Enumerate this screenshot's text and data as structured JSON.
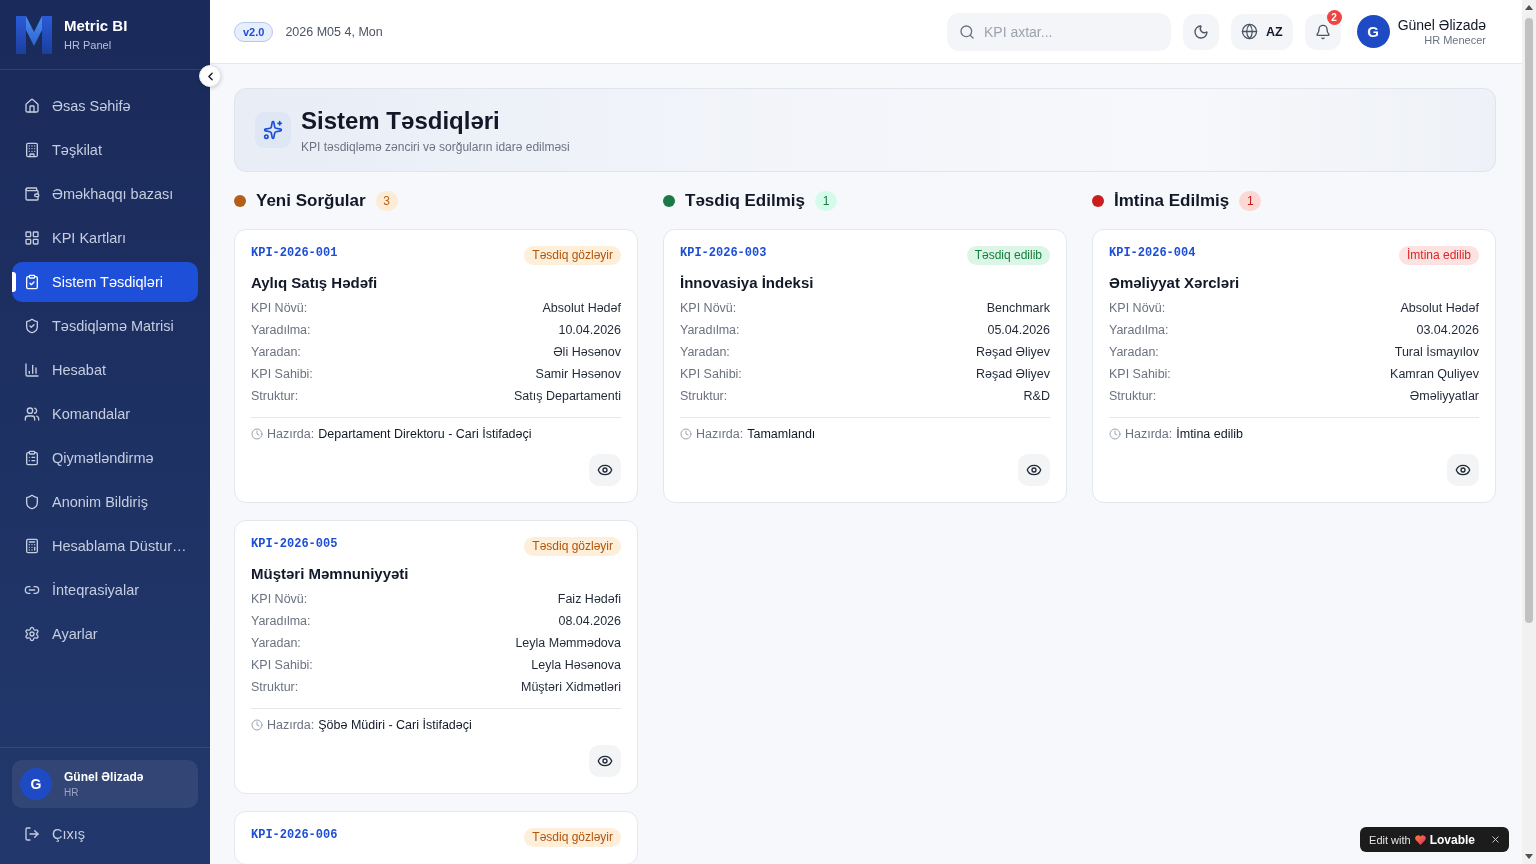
{
  "sidebar": {
    "brand": {
      "name": "Metric BI",
      "subtitle": "HR Panel"
    },
    "nav": [
      {
        "label": "Əsas Səhifə",
        "selected": false
      },
      {
        "label": "Təşkilat",
        "selected": false
      },
      {
        "label": "Əməkhaqqı bazası",
        "selected": false
      },
      {
        "label": "KPI Kartları",
        "selected": false
      },
      {
        "label": "Sistem Təsdiqləri",
        "selected": true
      },
      {
        "label": "Təsdiqləmə Matrisi",
        "selected": false
      },
      {
        "label": "Hesabat",
        "selected": false
      },
      {
        "label": "Komandalar",
        "selected": false
      },
      {
        "label": "Qiymətləndirmə",
        "selected": false
      },
      {
        "label": "Anonim Bildiriş",
        "selected": false
      },
      {
        "label": "Hesablama Düstur…",
        "selected": false
      },
      {
        "label": "İnteqrasiyalar",
        "selected": false
      },
      {
        "label": "Ayarlar",
        "selected": false
      }
    ],
    "user": {
      "initial": "G",
      "name": "Günel Əlizadə",
      "role": "HR"
    },
    "logout": "Çıxış"
  },
  "header": {
    "version": "v2.0",
    "date": "2026 M05 4, Mon",
    "search": {
      "placeholder": "KPI axtar..."
    },
    "language": "AZ",
    "notifications": "2",
    "user": {
      "initial": "G",
      "name": "Günel Əlizadə",
      "role": "HR Menecer"
    }
  },
  "page": {
    "title": "Sistem Təsdiqləri",
    "subtitle": "KPI təsdiqləmə zənciri və sorğuların idarə edilməsi"
  },
  "columns": [
    {
      "title": "Yeni Sorğular",
      "count": "3",
      "color": "#b45f17",
      "cards": [
        {
          "id": "KPI-2026-001",
          "status": {
            "label": "Təsdiq gözləyir",
            "kind": "pending"
          },
          "title": "Aylıq Satış Hədəfi",
          "fields": [
            {
              "label": "KPI Növü:",
              "value": "Absolut Hədəf"
            },
            {
              "label": "Yaradılma:",
              "value": "10.04.2026"
            },
            {
              "label": "Yaradan:",
              "value": "Əli Həsənov"
            },
            {
              "label": "KPI Sahibi:",
              "value": "Samir Həsənov"
            },
            {
              "label": "Struktur:",
              "value": "Satış Departamenti"
            }
          ],
          "current": {
            "label": "Hazırda:",
            "value": "Departament Direktoru - Cari İstifadəçi"
          }
        },
        {
          "id": "KPI-2026-005",
          "status": {
            "label": "Təsdiq gözləyir",
            "kind": "pending"
          },
          "title": "Müştəri Məmnuniyyəti",
          "fields": [
            {
              "label": "KPI Növü:",
              "value": "Faiz Hədəfi"
            },
            {
              "label": "Yaradılma:",
              "value": "08.04.2026"
            },
            {
              "label": "Yaradan:",
              "value": "Leyla Məmmədova"
            },
            {
              "label": "KPI Sahibi:",
              "value": "Leyla Həsənova"
            },
            {
              "label": "Struktur:",
              "value": "Müştəri Xidmətləri"
            }
          ],
          "current": {
            "label": "Hazırda:",
            "value": "Şöbə Müdiri - Cari İstifadəçi"
          }
        },
        {
          "id": "KPI-2026-006",
          "status": {
            "label": "Təsdiq gözləyir",
            "kind": "pending"
          }
        }
      ]
    },
    {
      "title": "Təsdiq Edilmiş",
      "count": "1",
      "color": "#1a7a45",
      "cards": [
        {
          "id": "KPI-2026-003",
          "status": {
            "label": "Təsdiq edilib",
            "kind": "approved"
          },
          "title": "İnnovasiya İndeksi",
          "fields": [
            {
              "label": "KPI Növü:",
              "value": "Benchmark"
            },
            {
              "label": "Yaradılma:",
              "value": "05.04.2026"
            },
            {
              "label": "Yaradan:",
              "value": "Rəşad Əliyev"
            },
            {
              "label": "KPI Sahibi:",
              "value": "Rəşad Əliyev"
            },
            {
              "label": "Struktur:",
              "value": "R&D"
            }
          ],
          "current": {
            "label": "Hazırda:",
            "value": "Tamamlandı"
          }
        }
      ]
    },
    {
      "title": "İmtina Edilmiş",
      "count": "1",
      "color": "#c81e1e",
      "cards": [
        {
          "id": "KPI-2026-004",
          "status": {
            "label": "İmtina edilib",
            "kind": "rejected"
          },
          "title": "Əməliyyat Xərcləri",
          "fields": [
            {
              "label": "KPI Növü:",
              "value": "Absolut Hədəf"
            },
            {
              "label": "Yaradılma:",
              "value": "03.04.2026"
            },
            {
              "label": "Yaradan:",
              "value": "Tural İsmayılov"
            },
            {
              "label": "KPI Sahibi:",
              "value": "Kamran Quliyev"
            },
            {
              "label": "Struktur:",
              "value": "Əməliyyatlar"
            }
          ],
          "current": {
            "label": "Hazırda:",
            "value": "İmtina edilib"
          }
        }
      ]
    }
  ],
  "edit_badge": {
    "label": "Edit with",
    "brand": "Lovable"
  }
}
